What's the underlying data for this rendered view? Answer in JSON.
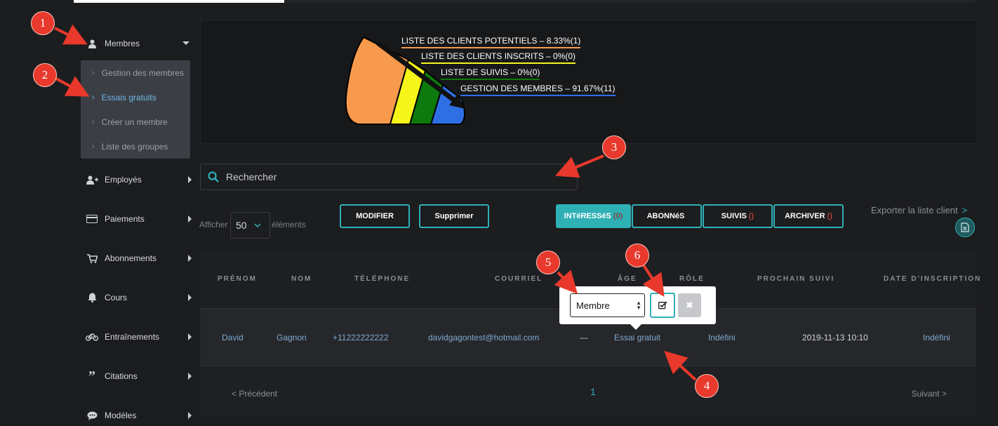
{
  "sidebar": {
    "items": [
      {
        "label": "Membres",
        "icon": "user-icon"
      },
      {
        "label": "Employés",
        "icon": "user-plus-icon"
      },
      {
        "label": "Paiements",
        "icon": "credit-card-icon"
      },
      {
        "label": "Abonnements",
        "icon": "cart-icon"
      },
      {
        "label": "Cours",
        "icon": "bell-icon"
      },
      {
        "label": "Entraînements",
        "icon": "bicycle-icon"
      },
      {
        "label": "Citations",
        "icon": "quote-icon"
      },
      {
        "label": "Modèles",
        "icon": "comment-icon"
      }
    ],
    "submenu": [
      {
        "label": "Gestion des membres"
      },
      {
        "label": "Essais gratuits"
      },
      {
        "label": "Créer un membre"
      },
      {
        "label": "Liste des groupes"
      }
    ]
  },
  "funnel": {
    "labels": [
      {
        "text": "LISTE DES CLIENTS POTENTIELS – 8.33%(1)",
        "color": "#f79a4e"
      },
      {
        "text": "LISTE DES CLIENTS INSCRITS – 0%(0)",
        "color": "#f5f51a"
      },
      {
        "text": "LISTE DE SUIVIS – 0%(0)",
        "color": "#0c7a0c"
      },
      {
        "text": "GESTION DES MEMBRES – 91.67%(11)",
        "color": "#2f6fe4"
      }
    ]
  },
  "search": {
    "placeholder": "Rechercher"
  },
  "toolbar": {
    "afficher": "Afficher",
    "page_size": "50",
    "elements": "éléments",
    "modifier": "MODIFIER",
    "supprimer": "Supprimer",
    "tabs": [
      {
        "label": "INTéRESSéS",
        "count": "(0)"
      },
      {
        "label": "ABONNéS",
        "count": ""
      },
      {
        "label": "SUIVIS",
        "count": "()"
      },
      {
        "label": "ARCHIVER",
        "count": "()"
      }
    ],
    "export": "Exporter la liste client",
    "export_arrow": ">"
  },
  "table": {
    "headers": [
      "PRÉNOM",
      "NOM",
      "TÉLÉPHONE",
      "COURRIEL",
      "ÂGE",
      "RÔLE",
      "PROCHAIN SUIVI",
      "DATE D'INSCRIPTION"
    ],
    "rows": [
      {
        "prenom": "David",
        "nom": "Gagnon",
        "telephone": "+11222222222",
        "courriel": "davidgagontest@hotmail.com",
        "age": "---",
        "role": "Essai gratuit",
        "prochain_suivi": "Indéfini",
        "date_inscription": "2019-11-13 10:10",
        "extra": "Indéfini"
      }
    ]
  },
  "pagination": {
    "prev": "< Précédent",
    "page": "1",
    "next": "Suivant >"
  },
  "popover": {
    "selected": "Membre"
  },
  "markers": [
    "1",
    "2",
    "3",
    "4",
    "5",
    "6"
  ],
  "colors": {
    "accent": "#2fb0b5",
    "marker": "#e8392c",
    "link": "#7fa9cf"
  }
}
